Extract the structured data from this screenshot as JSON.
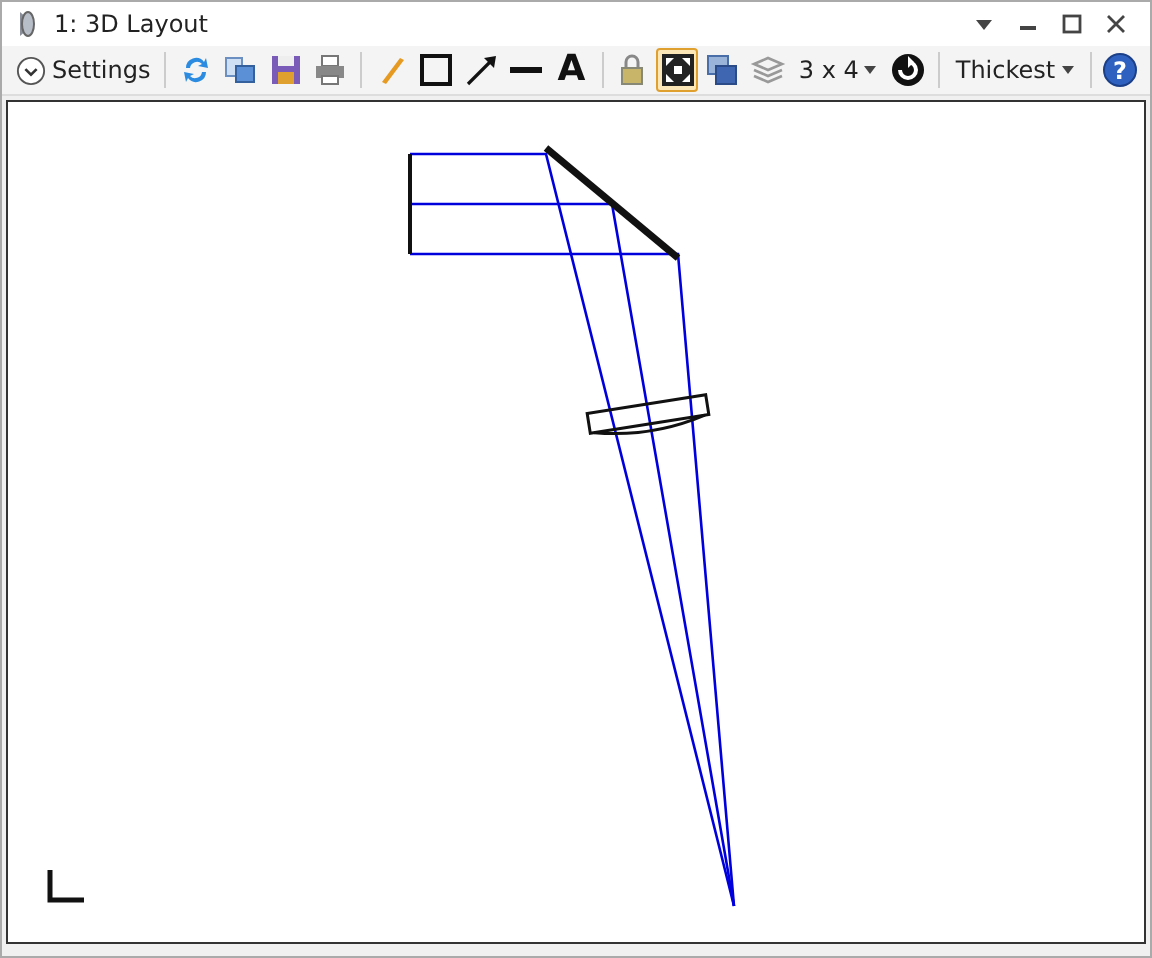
{
  "window": {
    "title": "1: 3D Layout"
  },
  "toolbar": {
    "settings_label": "Settings",
    "tools": [
      {
        "kind": "refresh",
        "selected": false
      },
      {
        "kind": "copy",
        "selected": false
      },
      {
        "kind": "save",
        "selected": false
      },
      {
        "kind": "print",
        "selected": false
      },
      {
        "kind": "sep"
      },
      {
        "kind": "pencil",
        "selected": false
      },
      {
        "kind": "rectangle",
        "selected": false
      },
      {
        "kind": "arrow",
        "selected": false
      },
      {
        "kind": "line",
        "selected": false
      },
      {
        "kind": "text",
        "label": "A",
        "selected": false
      },
      {
        "kind": "sep"
      },
      {
        "kind": "lock",
        "selected": false
      },
      {
        "kind": "fit",
        "selected": true
      },
      {
        "kind": "windows",
        "selected": false
      },
      {
        "kind": "layers",
        "selected": false
      },
      {
        "kind": "dropdown",
        "label": "3 x 4"
      },
      {
        "kind": "rotate",
        "selected": false
      },
      {
        "kind": "sep"
      },
      {
        "kind": "dropdown",
        "label": "Thickest"
      },
      {
        "kind": "sep"
      },
      {
        "kind": "help",
        "label": "?",
        "selected": false
      }
    ]
  }
}
